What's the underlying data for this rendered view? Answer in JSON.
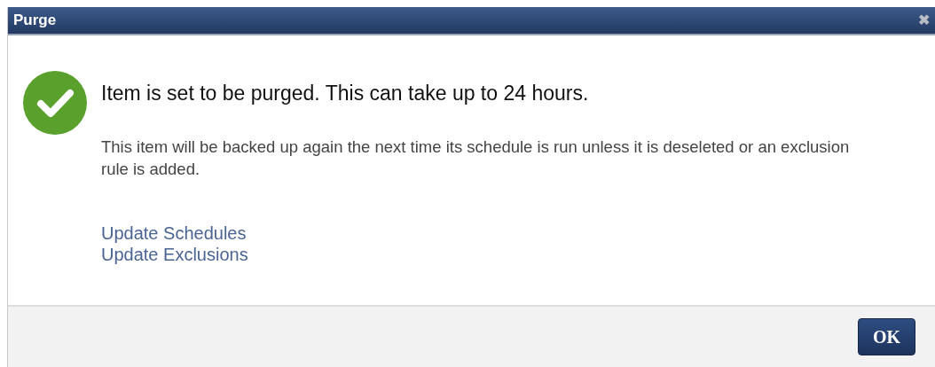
{
  "window": {
    "title": "Purge",
    "close": "✖"
  },
  "message": {
    "heading": "Item is set to be purged. This can take up to 24 hours.",
    "body": "This item will be backed up again the next time its schedule is run unless it is deseleted or an exclusion rule is added."
  },
  "links": [
    "Update Schedules",
    "Update Exclusions"
  ],
  "buttons": [
    "OK"
  ]
}
